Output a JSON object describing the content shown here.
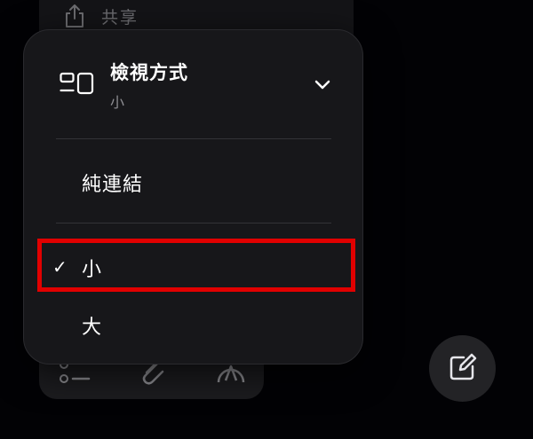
{
  "background": {
    "share_label": "共享"
  },
  "menu": {
    "header": {
      "title": "檢視方式",
      "subtitle": "小",
      "icon": "view-layout-icon",
      "chevron": "chevron-down-icon"
    },
    "items": [
      {
        "label": "純連結",
        "checked": false
      },
      {
        "label": "小",
        "checked": true
      },
      {
        "label": "大",
        "checked": false
      }
    ],
    "checkmark": "✓"
  },
  "toolbar": {
    "icons": [
      "checklist-icon",
      "paperclip-icon",
      "markup-pen-icon"
    ]
  },
  "compose_icon": "compose-icon",
  "colors": {
    "highlight": "#e10000",
    "menu_bg": "#17171a"
  }
}
